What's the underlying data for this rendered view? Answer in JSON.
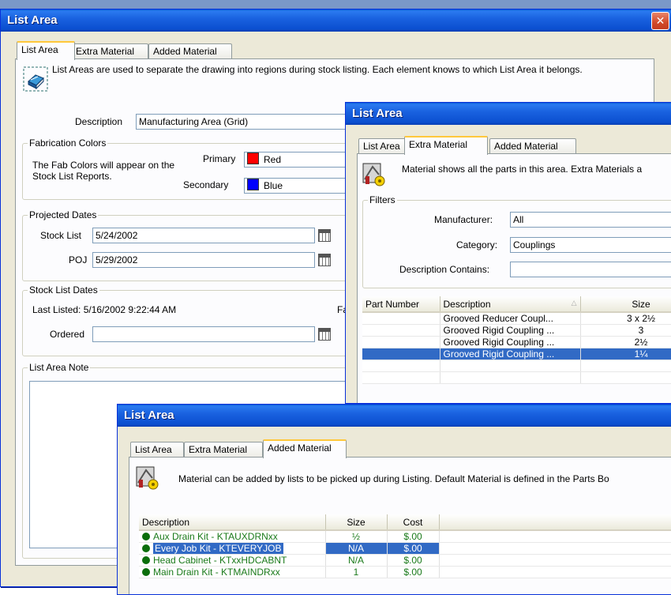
{
  "win1": {
    "title": "List Area",
    "close": "✕",
    "tabs": [
      "List Area",
      "Extra Material",
      "Added Material"
    ],
    "info": "List Areas are used to separate the drawing into regions during stock listing. Each element knows to which List Area it belongs.",
    "description_label": "Description",
    "description_value": "Manufacturing Area (Grid)",
    "fab_group": "Fabrication Colors",
    "fab_text": "The Fab Colors will appear on the Stock List Reports.",
    "primary_label": "Primary",
    "primary_value": "Red",
    "primary_color": "#ff0000",
    "secondary_label": "Secondary",
    "secondary_value": "Blue",
    "secondary_color": "#0000ff",
    "projected_group": "Projected Dates",
    "stock_list_label": "Stock List",
    "stock_list_value": "5/24/2002",
    "poj_label": "POJ",
    "poj_value": "5/29/2002",
    "stock_dates_group": "Stock List Dates",
    "last_listed": "Last Listed: 5/16/2002 9:22:44 AM",
    "fa_fragment": "Fa",
    "ordered_label": "Ordered",
    "ordered_value": "",
    "note_group": "List Area Note",
    "icon": "book-icon"
  },
  "win2": {
    "title": "List Area",
    "tabs": [
      "List Area",
      "Extra Material",
      "Added Material"
    ],
    "info": "Material shows all the parts in this area. Extra Materials a",
    "filters_group": "Filters",
    "manufacturer_label": "Manufacturer:",
    "manufacturer_value": "All",
    "category_label": "Category:",
    "category_value": "Couplings",
    "desc_contains_label": "Description Contains:",
    "desc_contains_value": "",
    "columns": [
      "Part Number",
      "Description",
      "Size"
    ],
    "rows": [
      {
        "part": "",
        "desc": "Grooved Reducer Coupl...",
        "size": "3 x 2½"
      },
      {
        "part": "",
        "desc": "Grooved Rigid Coupling ...",
        "size": "3"
      },
      {
        "part": "",
        "desc": "Grooved Rigid Coupling ...",
        "size": "2½"
      },
      {
        "part": "",
        "desc": "Grooved Rigid Coupling ...",
        "size": "1¼"
      }
    ],
    "selected_row": 3,
    "icon": "material-icon"
  },
  "win3": {
    "title": "List Area",
    "tabs": [
      "List Area",
      "Extra Material",
      "Added Material"
    ],
    "info": "Material can be added by lists to be picked up during Listing. Default Material is defined in the Parts Bo",
    "columns": [
      "Description",
      "Size",
      "Cost"
    ],
    "rows": [
      {
        "desc": "Aux Drain Kit - KTAUXDRNxx",
        "size": "½",
        "cost": "$.00"
      },
      {
        "desc": "Every Job Kit - KTEVERYJOB",
        "size": "N/A",
        "cost": "$.00"
      },
      {
        "desc": "Head Cabinet - KTxxHDCABNT",
        "size": "N/A",
        "cost": "$.00"
      },
      {
        "desc": "Main Drain Kit - KTMAINDRxx",
        "size": "1",
        "cost": "$.00"
      }
    ],
    "selected_row": 1,
    "icon": "material-icon"
  }
}
